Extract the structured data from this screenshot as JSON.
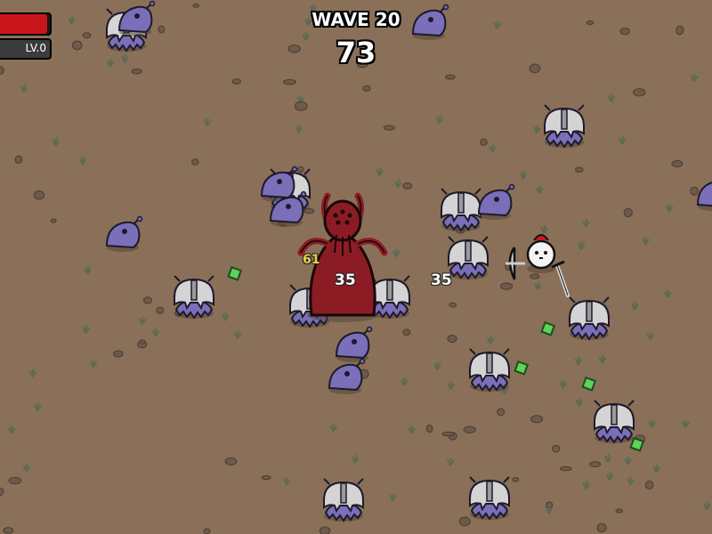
{
  "hud": {
    "wave_label": "WAVE 20",
    "timer": "73",
    "health_fraction": 0.95,
    "xp_fraction": 0.0,
    "level_label": "LV.0"
  },
  "floating_damage": [
    {
      "value": "35",
      "color": "#ffffff"
    },
    {
      "value": "35",
      "color": "#ffffff"
    },
    {
      "value": "61",
      "color": "#e8d24a"
    }
  ],
  "colors": {
    "ground": "#8a7058",
    "enemy_body": "#7a6fb8",
    "enemy_helmet": "#d4d4d4",
    "boss_body": "#8c1c24",
    "material_green": "#5ed35a",
    "hp_red": "#c8161c"
  }
}
